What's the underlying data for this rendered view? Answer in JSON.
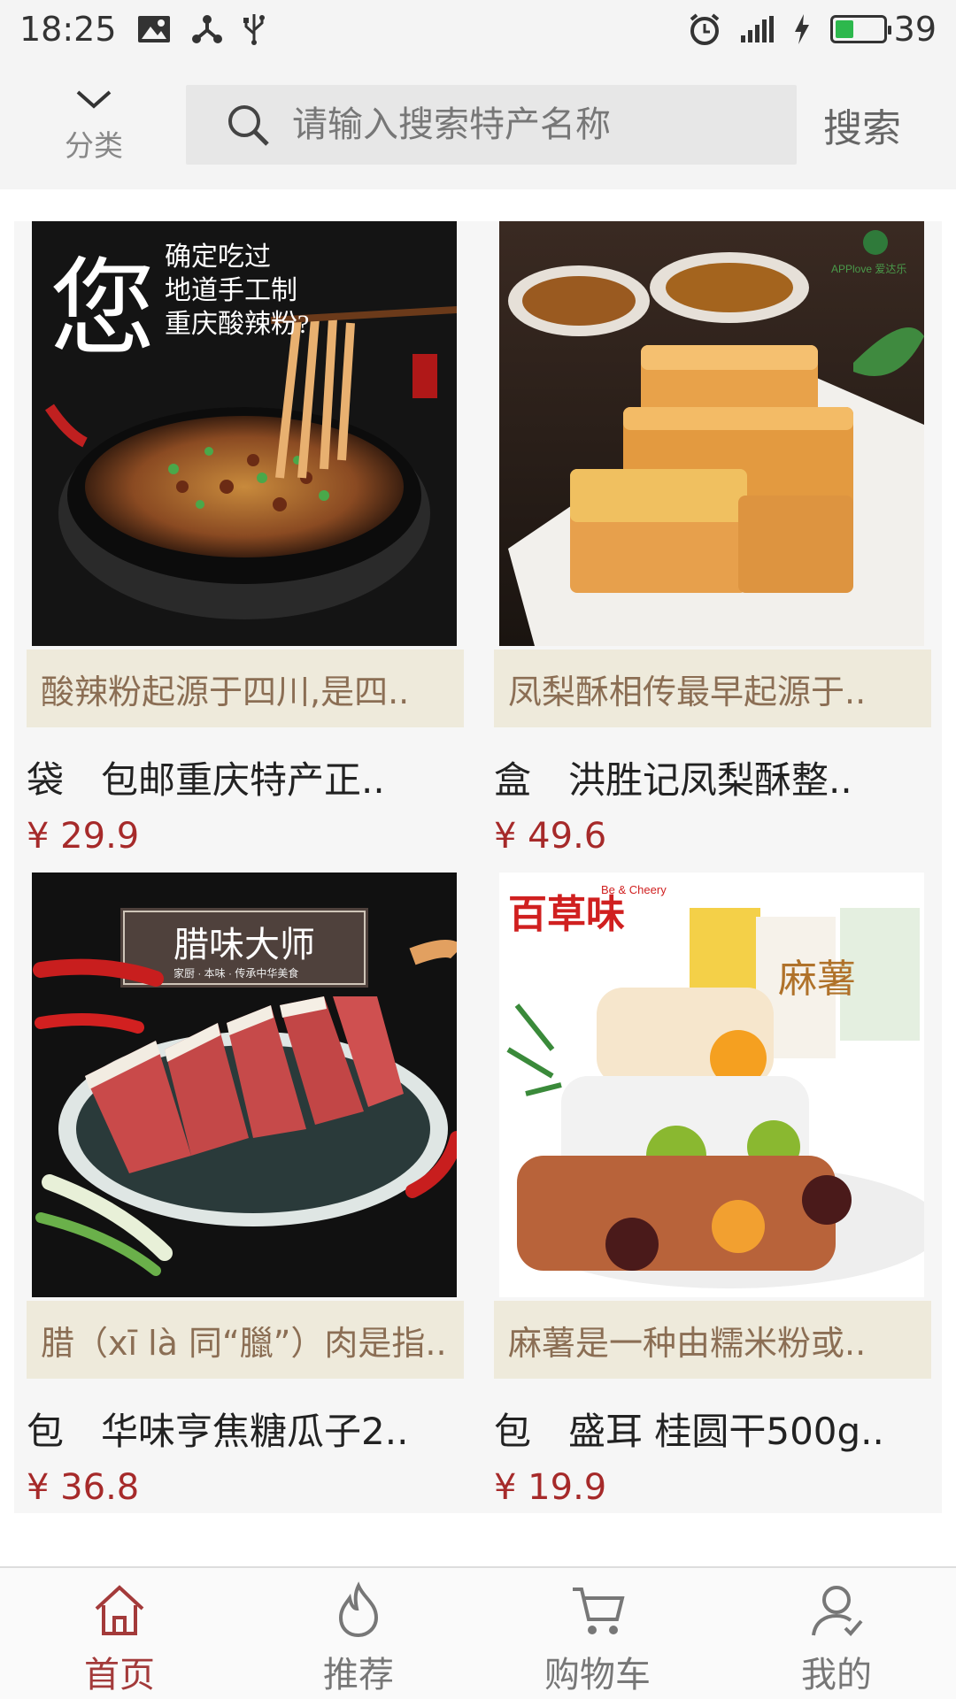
{
  "status_bar": {
    "time": "18:25",
    "battery_level": "39",
    "network": "4G"
  },
  "header": {
    "category_label": "分类",
    "search_placeholder": "请输入搜索特产名称",
    "search_button": "搜索"
  },
  "products": [
    {
      "image_text": [
        "您",
        "确定吃过",
        "地道手工制",
        "重庆酸辣粉?"
      ],
      "description": "酸辣粉起源于四川,是四..",
      "title": "袋　包邮重庆特产正..",
      "price": "¥ 29.9"
    },
    {
      "image_text": [
        "APPlove 爱达乐"
      ],
      "description": "凤梨酥相传最早起源于..",
      "title": "盒　洪胜记凤梨酥整..",
      "price": "¥ 49.6"
    },
    {
      "image_text": [
        "腊味大师",
        "家厨 · 本味 · 传承中华美食"
      ],
      "description": "腊（xī là 同“臘”）肉是指..",
      "title": "包　华味亨焦糖瓜子2..",
      "price": "¥ 36.8"
    },
    {
      "image_text": [
        "百草味",
        "Be & Cheery",
        "麻薯"
      ],
      "description": "麻薯是一种由糯米粉或..",
      "title": "包　盛耳 桂圆干500g..",
      "price": "¥ 19.9"
    }
  ],
  "bottom_nav": [
    {
      "label": "首页",
      "icon": "home-icon",
      "active": true
    },
    {
      "label": "推荐",
      "icon": "flame-icon",
      "active": false
    },
    {
      "label": "购物车",
      "icon": "cart-icon",
      "active": false
    },
    {
      "label": "我的",
      "icon": "user-icon",
      "active": false
    }
  ],
  "colors": {
    "accent": "#a33a3a",
    "price": "#a62a2a",
    "desc_bg": "#eeeadb",
    "desc_text": "#8b6e54"
  }
}
